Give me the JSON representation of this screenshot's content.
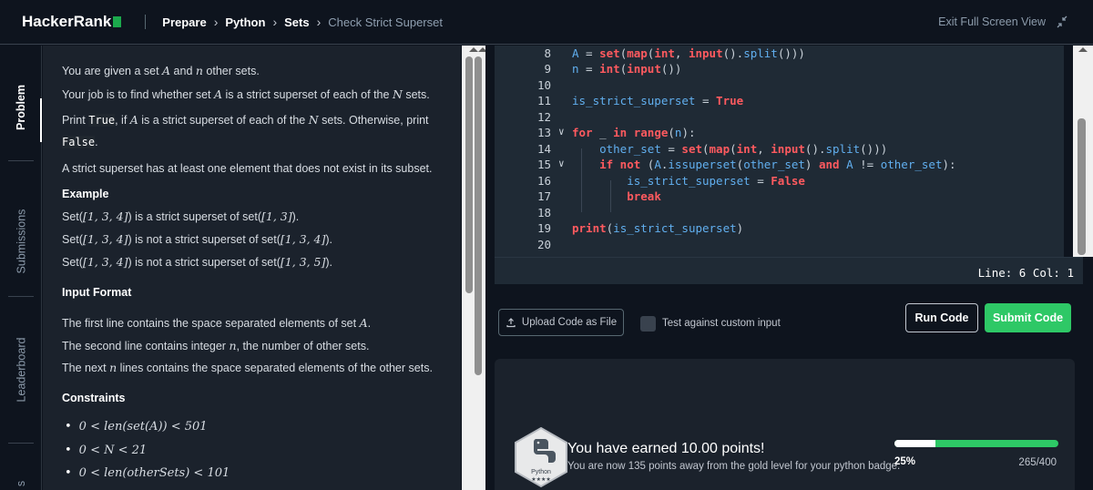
{
  "header": {
    "logo": "HackerRank",
    "breadcrumb": [
      "Prepare",
      "Python",
      "Sets",
      "Check Strict Superset"
    ],
    "exit_label": "Exit Full Screen View"
  },
  "tabs": [
    "Problem",
    "Submissions",
    "Leaderboard",
    "s"
  ],
  "problem": {
    "p1_a": "You are given a set ",
    "p1_b": "A",
    "p1_c": " and ",
    "p1_d": "n",
    "p1_e": " other sets.",
    "p2_a": "Your job is to find whether set ",
    "p2_b": "A",
    "p2_c": " is a strict superset of each of the ",
    "p2_d": "N",
    "p2_e": " sets.",
    "p3_a": "Print ",
    "p3_b": "True",
    "p3_c": ", if ",
    "p3_d": "A",
    "p3_e": " is a strict superset of each of the ",
    "p3_f": "N",
    "p3_g": " sets. Otherwise, print",
    "p4": "False",
    "p4_end": ".",
    "p5": "A strict superset has at least one element that does not exist in its subset.",
    "example_heading": "Example",
    "ex1_a": "Set(",
    "ex1_b": "[1, 3, 4]",
    "ex1_c": ") is a strict superset of set(",
    "ex1_d": "[1, 3]",
    "ex1_e": ").",
    "ex2_a": "Set(",
    "ex2_b": "[1, 3, 4]",
    "ex2_c": ") is not a strict superset of set(",
    "ex2_d": "[1, 3, 4]",
    "ex2_e": ").",
    "ex3_a": "Set(",
    "ex3_b": "[1, 3, 4]",
    "ex3_c": ") is not a strict superset of set(",
    "ex3_d": "[1, 3, 5]",
    "ex3_e": ").",
    "input_heading": "Input Format",
    "in1_a": "The first line contains the space separated elements of set ",
    "in1_b": "A",
    "in1_c": ".",
    "in2_a": "The second line contains integer ",
    "in2_b": "n",
    "in2_c": ", the number of other sets.",
    "in3_a": "The next ",
    "in3_b": "n",
    "in3_c": " lines contains the space separated elements of the other sets.",
    "constraints_heading": "Constraints",
    "c1": "0 < len(set(A)) < 501",
    "c2": "0 < N < 21",
    "c3": "0 < len(otherSets) < 101"
  },
  "editor": {
    "status": "Line: 6 Col: 1"
  },
  "actions": {
    "upload_label": "Upload Code as File",
    "custom_input_label": "Test against custom input",
    "run_label": "Run Code",
    "submit_label": "Submit Code"
  },
  "result": {
    "badge_name": "Python",
    "badge_stars": "★★★★",
    "earned": "You have earned 10.00 points!",
    "away": "You are now 135 points away from the gold level for your python badge.",
    "progress_percent": "25%",
    "progress_fraction": 0.25,
    "points": "265/400"
  },
  "colors": {
    "accent_green": "#2ec866",
    "keyword_red": "#ff5a5f",
    "identifier_blue": "#61afef",
    "panel_bg": "#1b222c",
    "editor_bg": "#1f2a35"
  }
}
